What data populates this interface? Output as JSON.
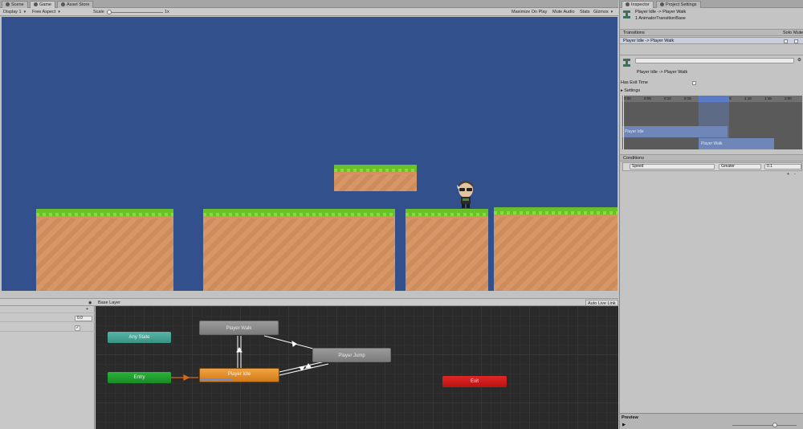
{
  "tabs": [
    {
      "label": "Scene"
    },
    {
      "label": "Game"
    },
    {
      "label": "Asset Store"
    }
  ],
  "toolbar": {
    "display": "Display 1",
    "aspect": "Free Aspect",
    "scale_label": "Scale",
    "scale_value": "1x",
    "maximize": "Maximize On Play",
    "mute": "Mute Audio",
    "stats": "Stats",
    "gizmos": "Gizmos"
  },
  "animator": {
    "layer": "Base Layer",
    "live_link": "Auto Live Link",
    "param_value": "0.0",
    "add": "+",
    "nodes": {
      "walk": "Player Walk",
      "jump": "Player Jump",
      "any": "Any State",
      "entry": "Entry",
      "idle": "Player Idle",
      "exit": "Exit"
    }
  },
  "inspector": {
    "tabs": [
      "Inspector",
      "Project Settings"
    ],
    "title": "Player Idle -> Player Walk",
    "subtitle": "1 AnimatorTransitionBase",
    "transitions_label": "Transitions",
    "solo": "Solo",
    "mute": "Mute",
    "transition_row": "Player Idle -> Player Walk",
    "transition_name": "Player Idle -> Player Walk",
    "has_exit_time": "Has Exit Time",
    "settings": "Settings",
    "ruler_ticks": [
      "0:00",
      "0:05",
      "0:10",
      "0:15",
      "1:00",
      "1:05",
      "1:10",
      "1:15",
      "2:00"
    ],
    "clip_idle": "Player Idle",
    "clip_walk": "Player Walk",
    "conditions": "Conditions",
    "condition": {
      "param": "Speed",
      "op": "Greater",
      "value": "0.1"
    },
    "cond_add": "+",
    "cond_remove": "-",
    "preview": "Preview"
  }
}
